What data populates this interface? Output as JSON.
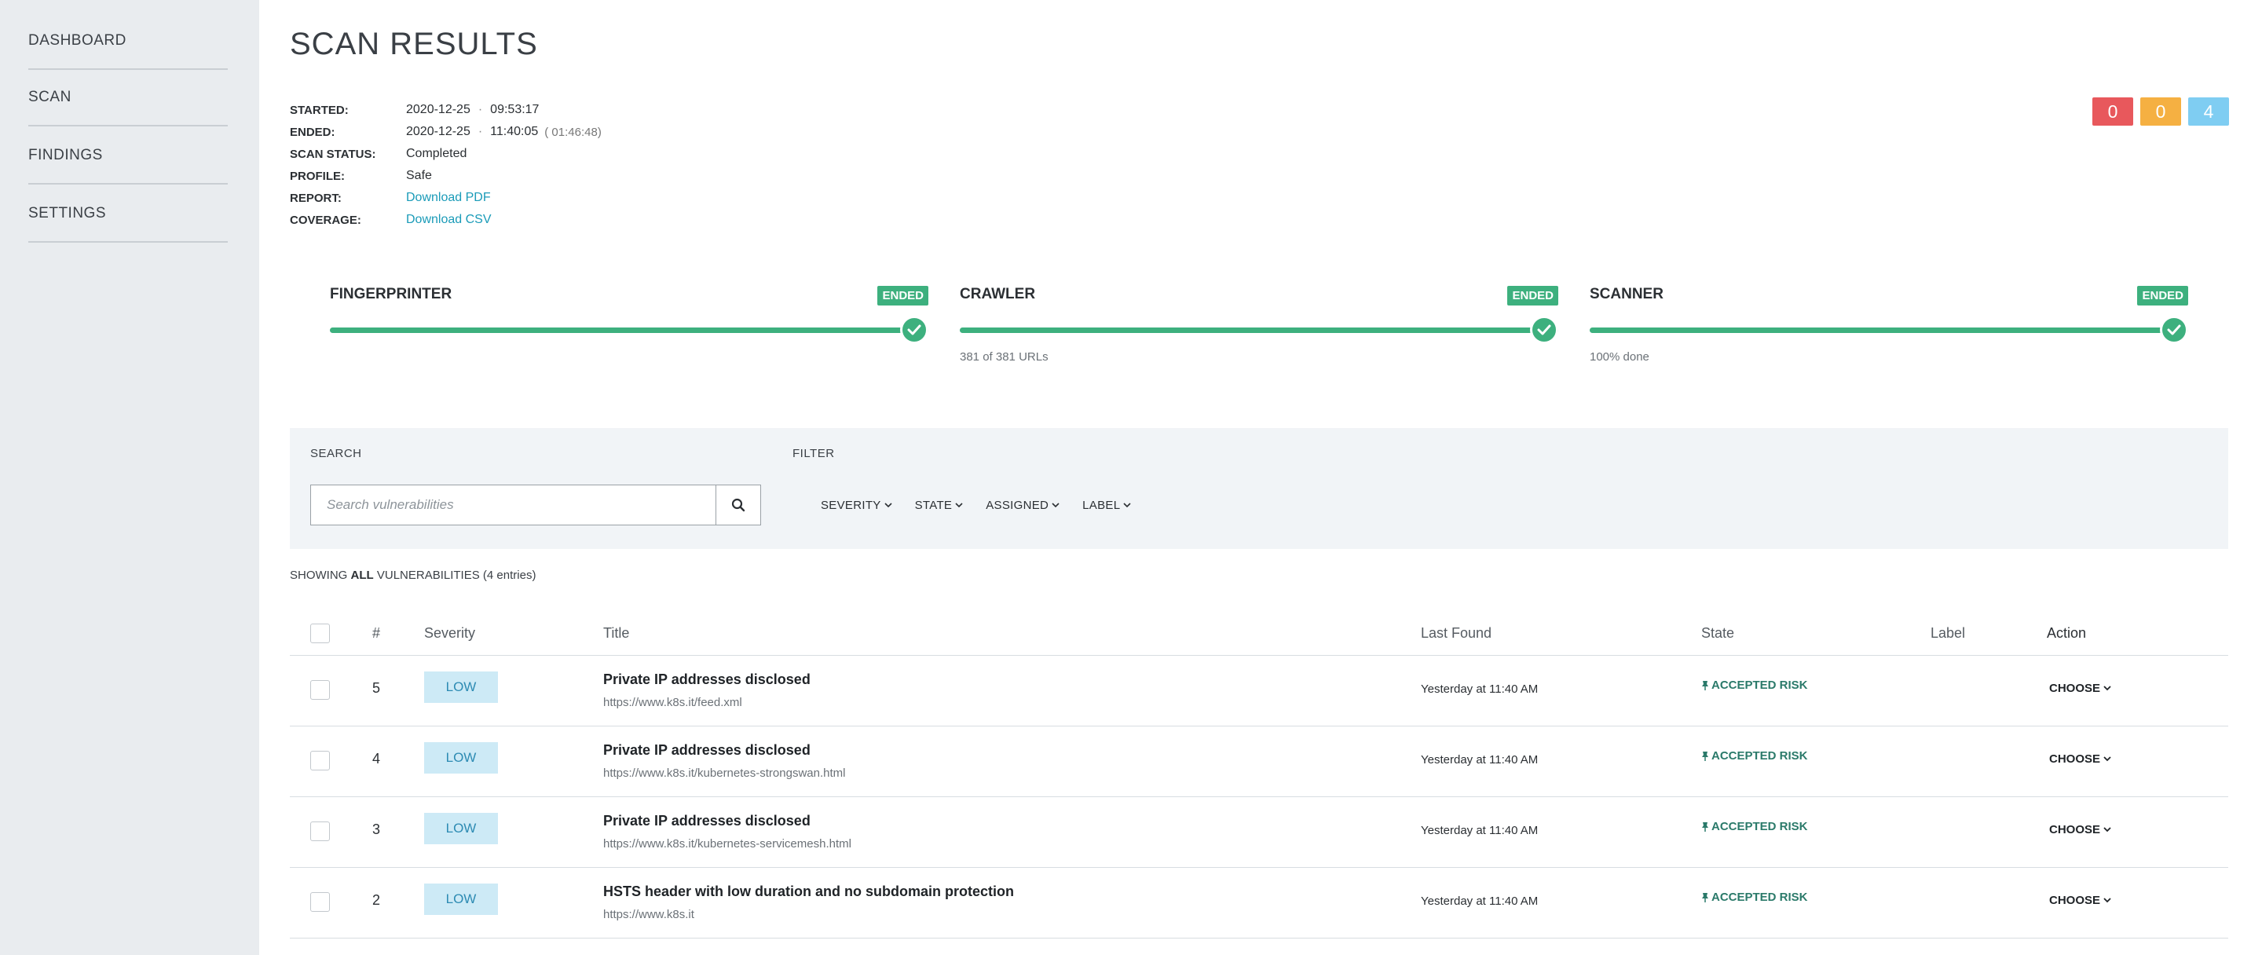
{
  "sidebar": {
    "items": [
      {
        "label": "DASHBOARD"
      },
      {
        "label": "SCAN"
      },
      {
        "label": "FINDINGS"
      },
      {
        "label": "SETTINGS"
      }
    ]
  },
  "page": {
    "title": "SCAN RESULTS"
  },
  "meta": {
    "started_label": "STARTED:",
    "started_date": "2020-12-25",
    "started_time": "09:53:17",
    "ended_label": "ENDED:",
    "ended_date": "2020-12-25",
    "ended_time": "11:40:05",
    "ended_duration": "( 01:46:48)",
    "status_label": "SCAN STATUS:",
    "status_value": "Completed",
    "profile_label": "PROFILE:",
    "profile_value": "Safe",
    "report_label": "REPORT:",
    "report_link": "Download PDF",
    "coverage_label": "COVERAGE:",
    "coverage_link": "Download CSV",
    "separator": "·"
  },
  "counters": [
    {
      "value": "0",
      "color": "#e8585c"
    },
    {
      "value": "0",
      "color": "#f5b042"
    },
    {
      "value": "4",
      "color": "#7fcdf2"
    }
  ],
  "stages": [
    {
      "name": "FINGERPRINTER",
      "badge": "ENDED",
      "note": "",
      "progress": 1.0
    },
    {
      "name": "CRAWLER",
      "badge": "ENDED",
      "note": "381 of 381 URLs",
      "progress": 1.0
    },
    {
      "name": "SCANNER",
      "badge": "ENDED",
      "note": "100% done",
      "progress": 1.0
    }
  ],
  "filters": {
    "search_label": "SEARCH",
    "filter_label": "FILTER",
    "search_placeholder": "Search vulnerabilities",
    "dropdowns": [
      "SEVERITY",
      "STATE",
      "ASSIGNED",
      "LABEL"
    ]
  },
  "showing": {
    "prefix": "SHOWING",
    "scope": "ALL",
    "suffix": "VULNERABILITIES",
    "count": "(4 entries)"
  },
  "table": {
    "headers": {
      "num": "#",
      "severity": "Severity",
      "title": "Title",
      "last_found": "Last Found",
      "state": "State",
      "label": "Label",
      "action": "Action"
    },
    "rows": [
      {
        "num": "5",
        "severity": "LOW",
        "title": "Private IP addresses disclosed",
        "url": "https://www.k8s.it/feed.xml",
        "last_found": "Yesterday at 11:40 AM",
        "state": "ACCEPTED RISK",
        "action": "CHOOSE"
      },
      {
        "num": "4",
        "severity": "LOW",
        "title": "Private IP addresses disclosed",
        "url": "https://www.k8s.it/kubernetes-strongswan.html",
        "last_found": "Yesterday at 11:40 AM",
        "state": "ACCEPTED RISK",
        "action": "CHOOSE"
      },
      {
        "num": "3",
        "severity": "LOW",
        "title": "Private IP addresses disclosed",
        "url": "https://www.k8s.it/kubernetes-servicemesh.html",
        "last_found": "Yesterday at 11:40 AM",
        "state": "ACCEPTED RISK",
        "action": "CHOOSE"
      },
      {
        "num": "2",
        "severity": "LOW",
        "title": "HSTS header with low duration and no subdomain protection",
        "url": "https://www.k8s.it",
        "last_found": "Yesterday at 11:40 AM",
        "state": "ACCEPTED RISK",
        "action": "CHOOSE"
      }
    ]
  },
  "colors": {
    "accent_green": "#3db07e",
    "link": "#1a9bb8",
    "severity_low_bg": "#cdeaf6",
    "severity_low_text": "#2d8bb3"
  }
}
